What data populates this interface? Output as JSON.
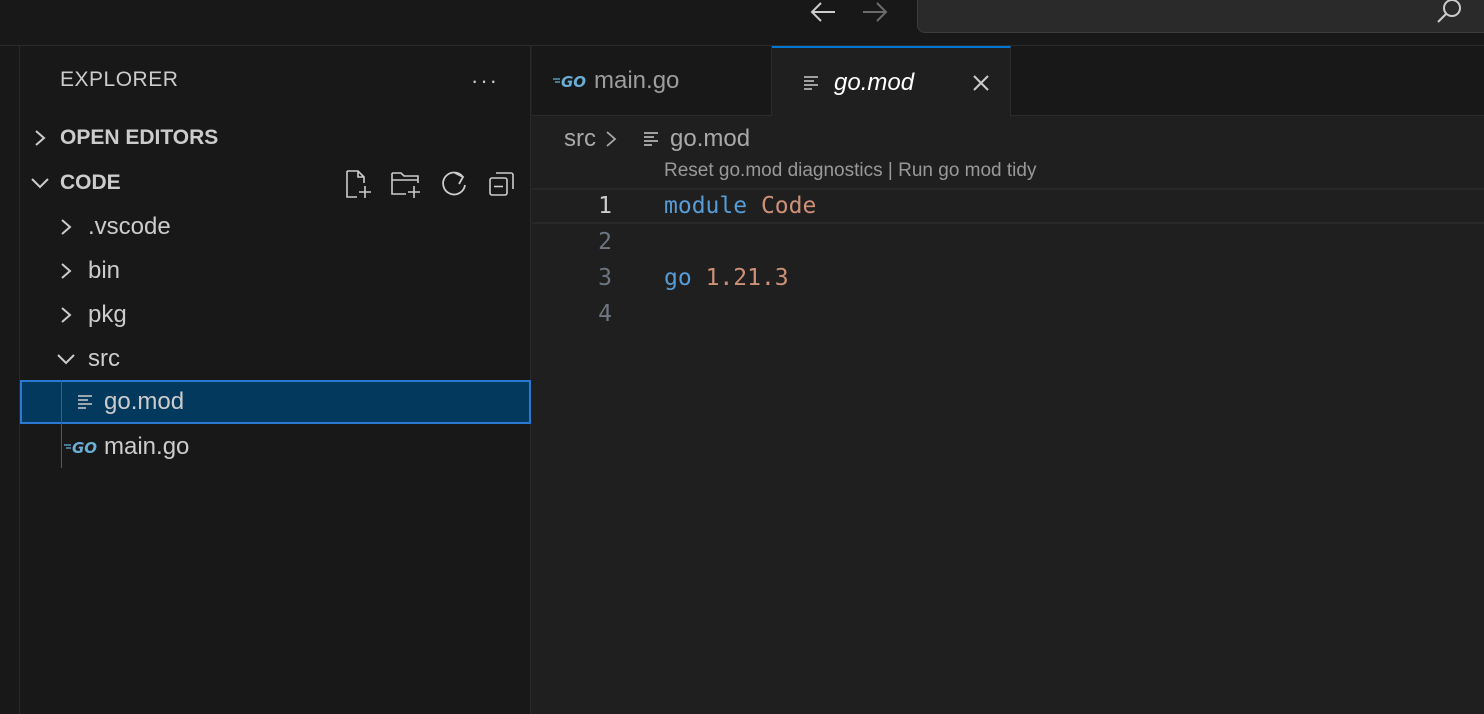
{
  "titlebar": {
    "back_icon": "arrow-left-icon",
    "forward_icon": "arrow-right-icon",
    "search_icon": "search-icon"
  },
  "sidebar": {
    "title": "EXPLORER",
    "more": "···",
    "open_editors": "OPEN EDITORS",
    "code_section": "CODE",
    "tree": [
      {
        "label": ".vscode",
        "type": "folder",
        "expanded": false
      },
      {
        "label": "bin",
        "type": "folder",
        "expanded": false
      },
      {
        "label": "pkg",
        "type": "folder",
        "expanded": false
      },
      {
        "label": "src",
        "type": "folder",
        "expanded": true
      },
      {
        "label": "go.mod",
        "type": "file",
        "icon": "lines-file-icon",
        "selected": true
      },
      {
        "label": "main.go",
        "type": "file",
        "icon": "go-file-icon"
      }
    ]
  },
  "editor": {
    "tabs": [
      {
        "label": "main.go",
        "icon": "go-file-icon",
        "active": false
      },
      {
        "label": "go.mod",
        "icon": "lines-file-icon",
        "active": true
      }
    ],
    "breadcrumb": {
      "folder": "src",
      "file": "go.mod"
    },
    "codelens": "Reset go.mod diagnostics | Run go mod tidy",
    "lines": [
      {
        "num": "1",
        "kw": "module",
        "val": "Code"
      },
      {
        "num": "2",
        "kw": "",
        "val": ""
      },
      {
        "num": "3",
        "kw": "go",
        "val": "1.21.3"
      },
      {
        "num": "4",
        "kw": "",
        "val": ""
      }
    ]
  },
  "colors": {
    "accent": "#0078d4",
    "selection": "#04395e",
    "keyword": "#569cd6",
    "string": "#ce9178",
    "go_blue": "#6aaed6"
  }
}
